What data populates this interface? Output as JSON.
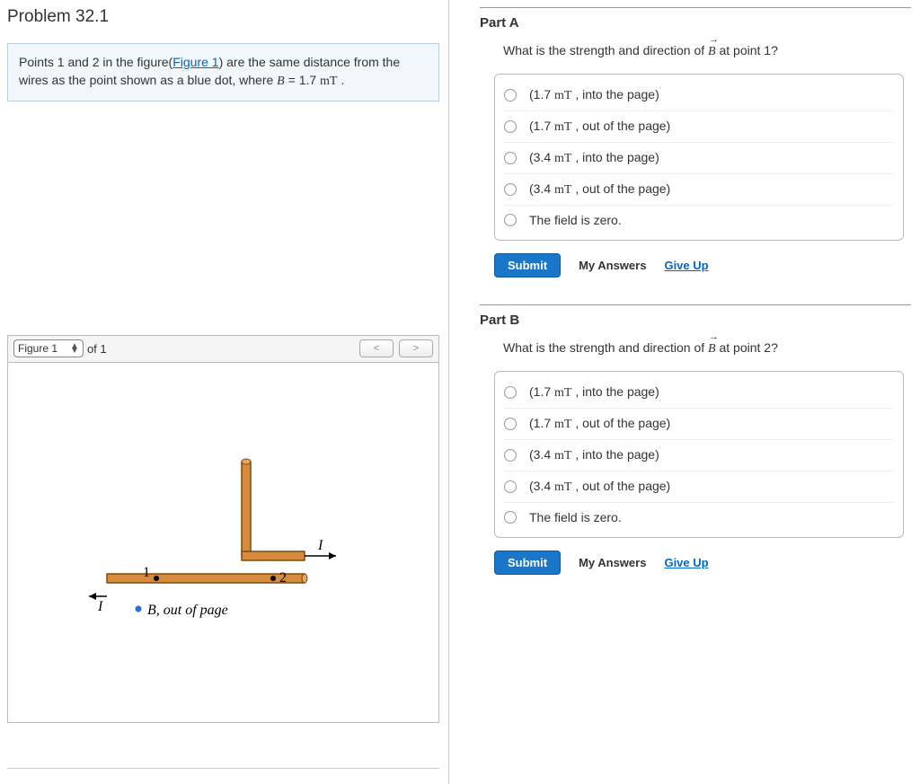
{
  "problem_title": "Problem 32.1",
  "intro": {
    "pre": "Points 1 and 2 in the figure(",
    "fig_link": "Figure 1",
    "post1": ") are the same distance from the wires as the point shown as a blue dot, where ",
    "B": "B",
    "eq": " = 1.7 ",
    "unit": "mT",
    "end": " ."
  },
  "figure": {
    "select_label": "Figure 1",
    "of_text": "of 1",
    "prev": "<",
    "next": ">",
    "labels": {
      "pt1": "1",
      "pt2": "2",
      "I_top": "I",
      "I_left": "I",
      "B_label": "B, out of page"
    }
  },
  "partA": {
    "title": "Part A",
    "question_pre": "What is the strength and direction of ",
    "question_post": " at point 1?",
    "choices": [
      "(1.7 mT , into the page)",
      "(1.7 mT , out of the page)",
      "(3.4 mT , into the page)",
      "(3.4 mT , out of the page)",
      "The field is zero."
    ],
    "submit": "Submit",
    "my_answers": "My Answers",
    "give_up": "Give Up"
  },
  "partB": {
    "title": "Part B",
    "question_pre": "What is the strength and direction of ",
    "question_post": " at point 2?",
    "choices": [
      "(1.7 mT , into the page)",
      "(1.7 mT , out of the page)",
      "(3.4 mT , into the page)",
      "(3.4 mT , out of the page)",
      "The field is zero."
    ],
    "submit": "Submit",
    "my_answers": "My Answers",
    "give_up": "Give Up"
  }
}
